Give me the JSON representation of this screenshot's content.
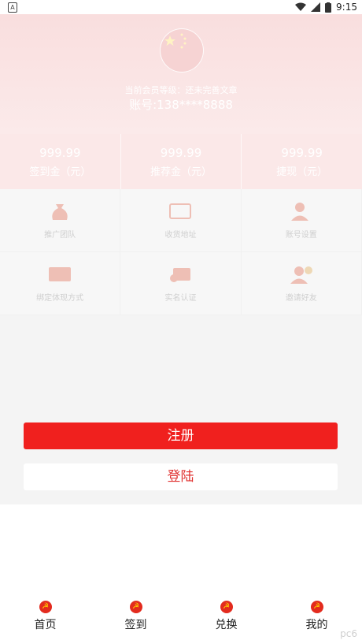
{
  "status_bar": {
    "time": "9:15",
    "left_icon": "A"
  },
  "profile": {
    "level_text": "当前会员等级：还未完善文章",
    "account_text": "账号:138****8888"
  },
  "stats": [
    {
      "value": "999.99",
      "label": "签到金（元）"
    },
    {
      "value": "999.99",
      "label": "推荐金（元）"
    },
    {
      "value": "999.99",
      "label": "捷现（元）"
    }
  ],
  "menu": [
    {
      "label": "推广团队",
      "icon": "money-bag-icon"
    },
    {
      "label": "收货地址",
      "icon": "ticket-icon"
    },
    {
      "label": "账号设置",
      "icon": "user-settings-icon"
    },
    {
      "label": "绑定体现方式",
      "icon": "card-icon"
    },
    {
      "label": "实名认证",
      "icon": "id-card-icon"
    },
    {
      "label": "邀请好友",
      "icon": "invite-icon"
    }
  ],
  "actions": {
    "register": "注册",
    "login": "登陆"
  },
  "tabs": [
    {
      "label": "首页"
    },
    {
      "label": "签到"
    },
    {
      "label": "兑换"
    },
    {
      "label": "我的"
    }
  ],
  "watermark": "pc6"
}
